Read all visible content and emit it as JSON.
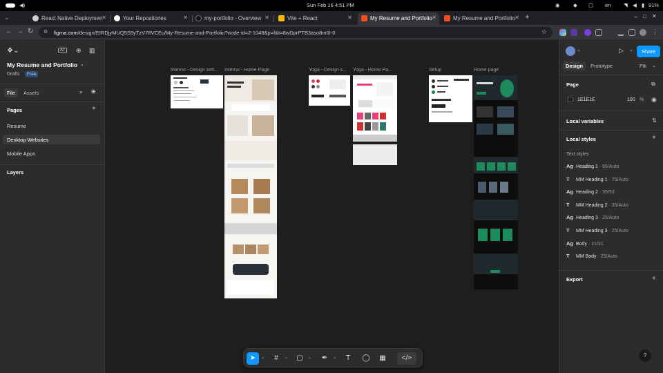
{
  "os": {
    "datetime": "Sun Feb 16   4:51 PM",
    "lang": "en",
    "battery": "91%"
  },
  "tabs": [
    {
      "title": "React Native Deploymen",
      "fav_color": "#cfcfcf"
    },
    {
      "title": "Your Repositories",
      "fav_color": "#ffffff"
    },
    {
      "title": "my-portfolio - Overview",
      "fav_color": "#111111"
    },
    {
      "title": "Vite + React",
      "fav_color": "#f5b700"
    },
    {
      "title": "My Resume and Portfolio",
      "fav_color": "#f24e1e"
    },
    {
      "title": "My Resume and Portfolio",
      "fav_color": "#f24e1e"
    }
  ],
  "url": {
    "host": "figma.com",
    "path": "/design/EIRDjyMUQ5S5yTzV78VCEu/My-Resume-and-Portfolio?node-id=2-1048&p=f&t=8wDprPTB3aso8m0I-0"
  },
  "file": {
    "title": "My Resume and Portfolio",
    "drafts": "Drafts",
    "plan": "Free"
  },
  "left": {
    "tabs": [
      "File",
      "Assets"
    ],
    "pages_heading": "Pages",
    "pages": [
      "Resume",
      "Desktop Websites",
      "Mobile Apps"
    ],
    "layers_heading": "Layers"
  },
  "frames": [
    {
      "label": "Interno - Design sett..."
    },
    {
      "label": "Interno - Home Page"
    },
    {
      "label": "Yoga - Design s..."
    },
    {
      "label": "Yoga - Home Pa..."
    },
    {
      "label": "Setup"
    },
    {
      "label": "Home page"
    }
  ],
  "right": {
    "tabs": [
      "Design",
      "Prototype"
    ],
    "zoom": "7%",
    "share": "Share",
    "page_heading": "Page",
    "page_color": "1E1E1E",
    "page_opacity": "100",
    "page_pct": "%",
    "local_variables": "Local variables",
    "local_styles": "Local styles",
    "text_styles_heading": "Text styles",
    "text_styles": [
      {
        "icon": "Ag",
        "name": "Heading 1",
        "meta": " · 65/Auto"
      },
      {
        "icon": "T",
        "name": "MM Heading 1",
        "meta": " · 75/Auto"
      },
      {
        "icon": "Ag",
        "name": "Heading 2",
        "meta": " · 35/53"
      },
      {
        "icon": "T",
        "name": "MM Heading 2",
        "meta": " · 35/Auto"
      },
      {
        "icon": "Ag",
        "name": "Heading 3",
        "meta": " · 25/Auto"
      },
      {
        "icon": "T",
        "name": "MM Heading 3",
        "meta": " · 25/Auto"
      },
      {
        "icon": "Ag",
        "name": "Body",
        "meta": " · 21/31"
      },
      {
        "icon": "T",
        "name": "MM Body",
        "meta": " · 25/Auto"
      }
    ],
    "export": "Export",
    "help": "?"
  },
  "colors": {
    "accent": "#0d99ff",
    "canvas": "#1e1e1e",
    "panel": "#2c2c2c"
  }
}
